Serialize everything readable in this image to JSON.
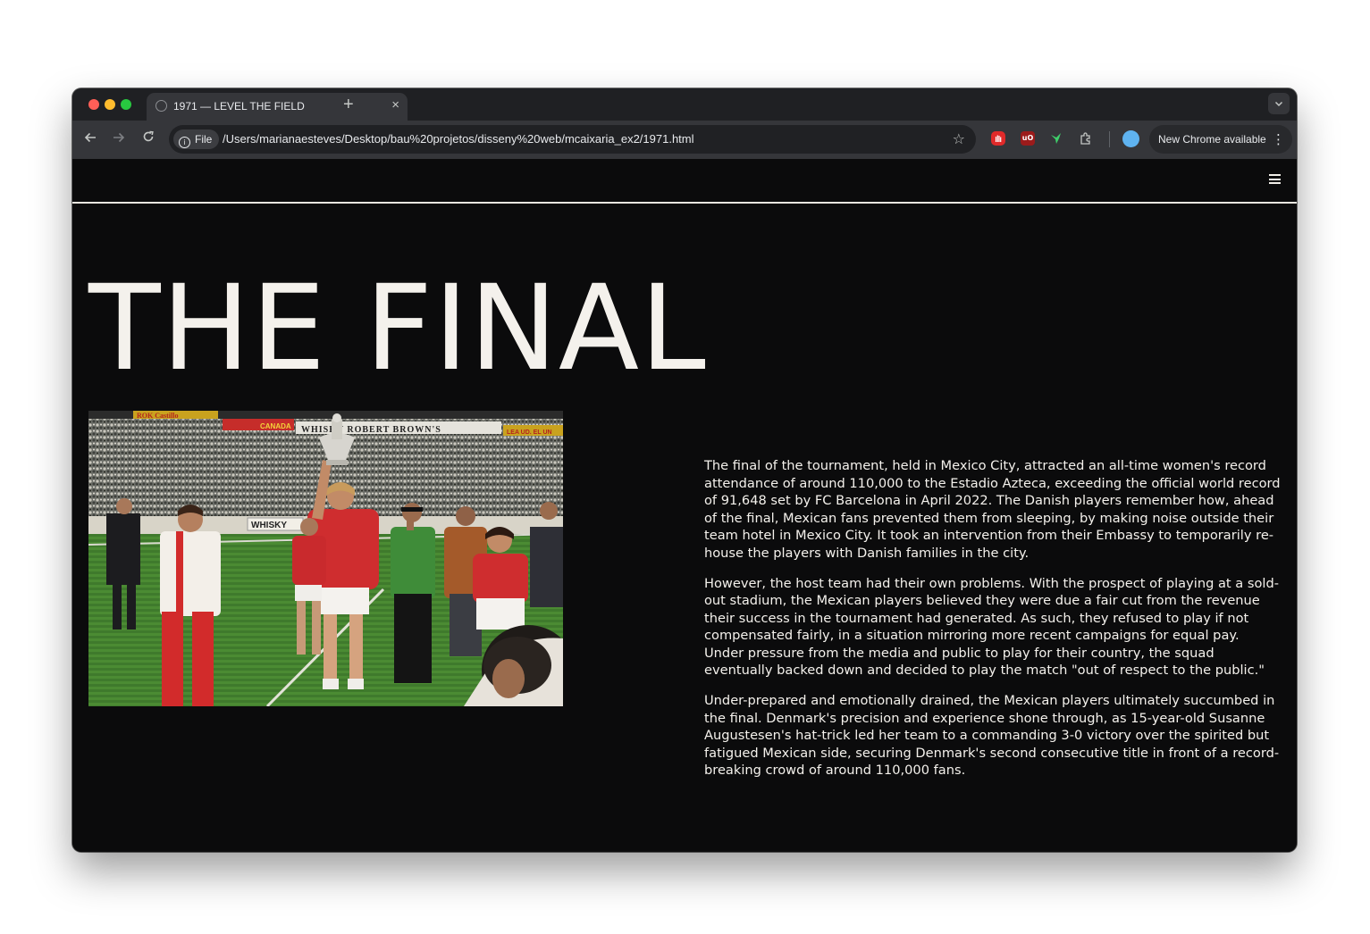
{
  "browser": {
    "tab_title": "1971 — LEVEL THE FIELD",
    "tab_close": "×",
    "new_tab": "+",
    "omnibox_chip": "File",
    "url": "/Users/marianaesteves/Desktop/bau%20projetos/disseny%20web/mcaixaria_ex2/1971.html",
    "update_label": "New Chrome available",
    "icons": {
      "back": "arrow-left-icon",
      "forward": "arrow-right-icon",
      "reload": "reload-icon",
      "info": "info-icon",
      "bookmark": "star-icon",
      "extension_puzzle": "puzzle-icon",
      "menu": "kebab-menu-icon"
    },
    "colors": {
      "tabstrip": "#1f2023",
      "toolbar": "#35363a",
      "page_background": "#0b0b0c",
      "text": "#f4f1ec"
    }
  },
  "page": {
    "title": "THE FINAL",
    "menu_icon": "hamburger-menu-icon",
    "paragraphs": [
      "The final of the tournament, held in Mexico City, attracted an all-time women's record attendance of around 110,000 to the Estadio Azteca, exceeding the official world record of 91,648 set by FC Barcelona in April 2022. The Danish players remember how, ahead of the final, Mexican fans prevented them from sleeping, by making noise outside their team hotel in Mexico City. It took an intervention from their Embassy to temporarily re-house the players with Danish families in the city.",
      "However, the host team had their own problems. With the prospect of playing at a sold-out stadium, the Mexican players believed they were due a fair cut from the revenue their success in the tournament had generated. As such, they refused to play if not compensated fairly, in a situation mirroring more recent campaigns for equal pay. Under pressure from the media and public to play for their country, the squad eventually backed down and decided to play the match \"out of respect to the public.\"",
      "Under-prepared and emotionally drained, the Mexican players ultimately succumbed in the final. Denmark's precision and experience shone through, as 15-year-old Susanne Augustesen's hat-trick led her team to a commanding 3-0 victory over the spirited but fatigued Mexican side, securing Denmark's second consecutive title in front of a record-breaking crowd of around 110,000 fans."
    ],
    "photo_banners": {
      "left": "ROK Castillo",
      "sponsor_1": "CANADA",
      "sponsor_2": "WHISKY ROBERT BROWN'S",
      "sponsor_3": "LEA UD. EL UN",
      "perimeter": "WHISKY"
    }
  }
}
